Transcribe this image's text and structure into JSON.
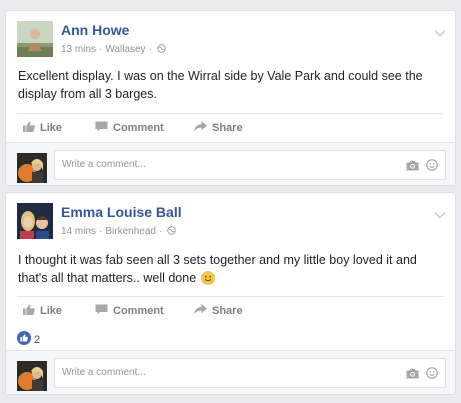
{
  "posts": [
    {
      "author": "Ann Howe",
      "time": "13 mins",
      "location": "Wallasey",
      "separator": "·",
      "text": "Excellent display. I was on the Wirral side by Vale Park and could see the display from all 3 barges.",
      "actions": {
        "like": "Like",
        "comment": "Comment",
        "share": "Share"
      },
      "comment_placeholder": "Write a comment..."
    },
    {
      "author": "Emma Louise Ball",
      "time": "14 mins",
      "location": "Birkenhead",
      "separator": "·",
      "text": "I thought it was fab seen all 3 sets together and my little boy loved it and that's all that matters.. well done",
      "actions": {
        "like": "Like",
        "comment": "Comment",
        "share": "Share"
      },
      "reaction_count": "2",
      "comment_placeholder": "Write a comment..."
    }
  ],
  "colors": {
    "page_bg": "#e9ebee",
    "card_bg": "#ffffff",
    "name_link": "#365899",
    "meta_text": "#90949c",
    "action_text": "#7f7f7f",
    "like_blue": "#4267b2"
  },
  "icons": [
    "globe-icon",
    "chevron-down-icon",
    "like-thumb-icon",
    "comment-bubble-icon",
    "share-arrow-icon",
    "like-reaction-icon",
    "smile-emoji-icon",
    "camera-icon",
    "smiley-icon"
  ]
}
